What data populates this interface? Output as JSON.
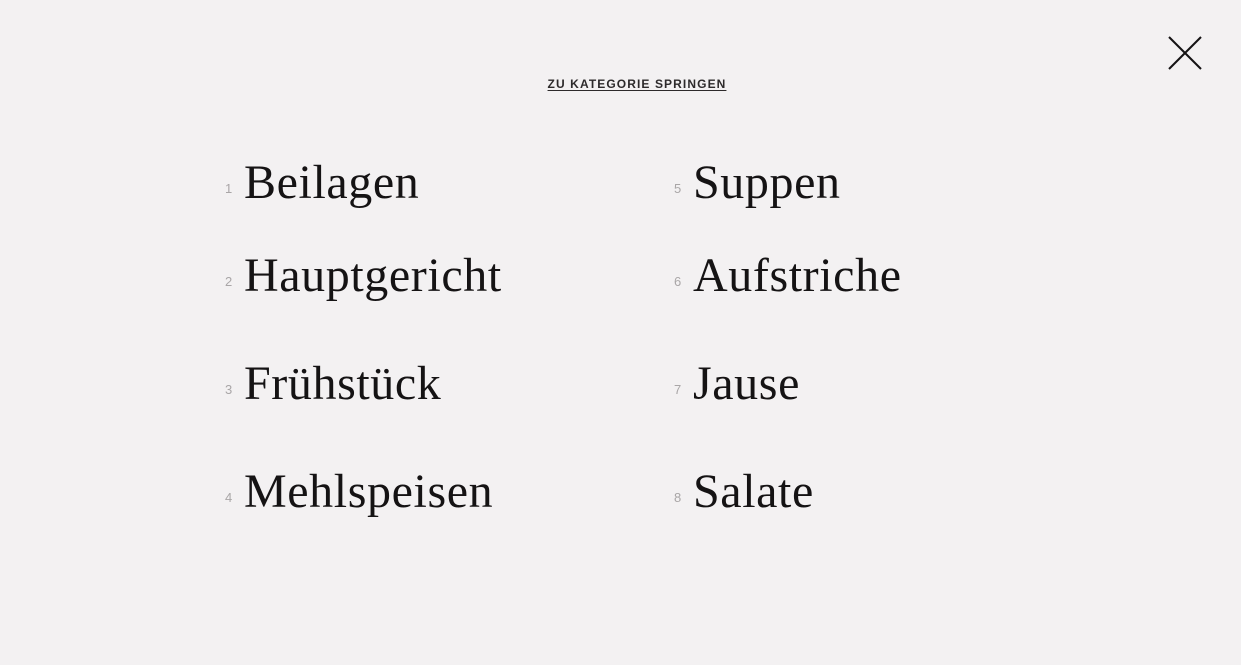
{
  "overlay": {
    "heading": "ZU KATEGORIE SPRINGEN",
    "close_icon": "close-icon"
  },
  "categories": [
    {
      "number": "1",
      "label": "Beilagen"
    },
    {
      "number": "2",
      "label": "Hauptgericht"
    },
    {
      "number": "3",
      "label": "Frühstück"
    },
    {
      "number": "4",
      "label": "Mehlspeisen"
    },
    {
      "number": "5",
      "label": "Suppen"
    },
    {
      "number": "6",
      "label": "Aufstriche"
    },
    {
      "number": "7",
      "label": "Jause"
    },
    {
      "number": "8",
      "label": "Salate"
    }
  ],
  "colors": {
    "background": "#f3f1f2",
    "text": "#151314",
    "number": "#a9a6a7"
  }
}
